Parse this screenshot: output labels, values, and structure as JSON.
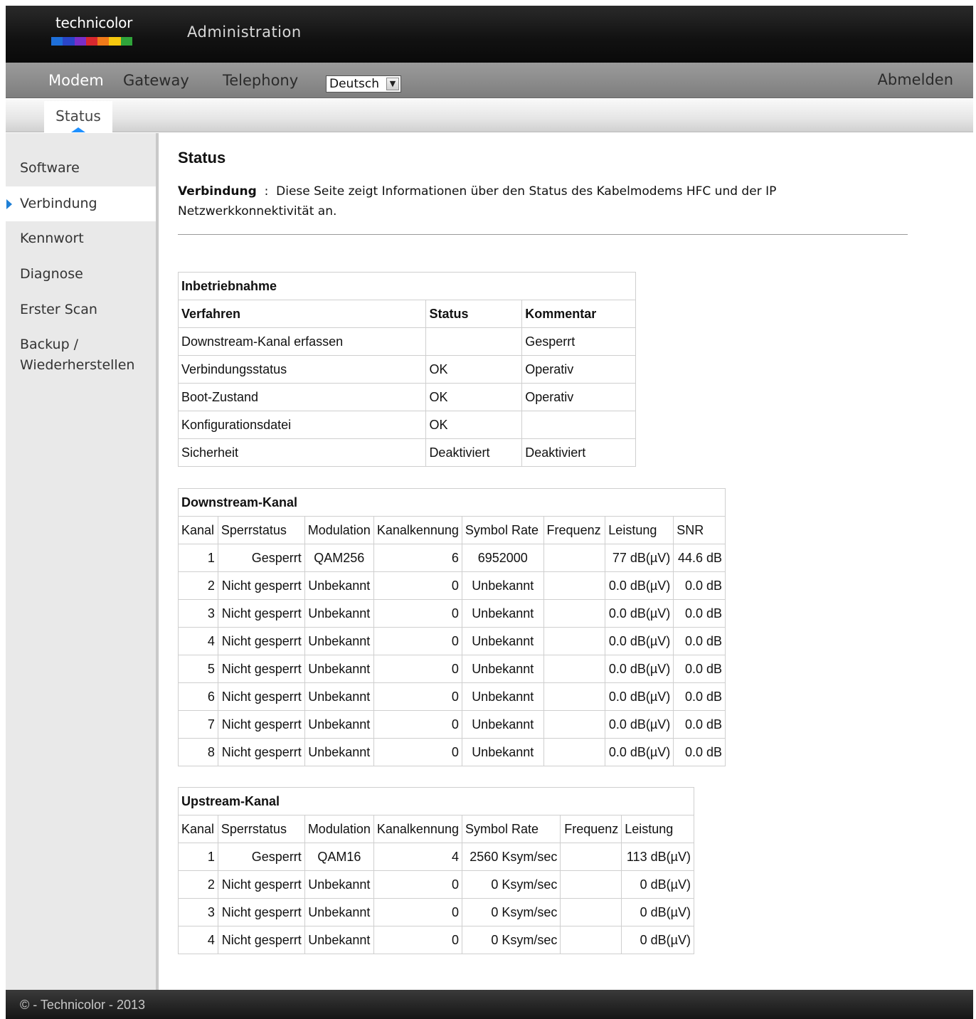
{
  "header": {
    "logo_text": "technicolor",
    "logo_colors": [
      "#1e6fd9",
      "#2a45c8",
      "#7a2ec8",
      "#d8282f",
      "#f07a19",
      "#f5c80f",
      "#2fa43a"
    ],
    "app_title": "Administration"
  },
  "nav": {
    "items": [
      {
        "label": "Modem"
      },
      {
        "label": "Gateway"
      },
      {
        "label": "Telephony"
      }
    ],
    "language": "Deutsch",
    "logout": "Abmelden"
  },
  "subnav": {
    "active_tab": "Status"
  },
  "sidebar": {
    "items": [
      {
        "label": "Software"
      },
      {
        "label": "Verbindung"
      },
      {
        "label": "Kennwort"
      },
      {
        "label": "Diagnose"
      },
      {
        "label": "Erster Scan"
      },
      {
        "label": "Backup /"
      },
      {
        "label": "Wiederherstellen"
      }
    ]
  },
  "main": {
    "title": "Status",
    "intro_label": "Verbindung",
    "intro_text_1": "  :  Diese Seite zeigt Informationen über den Status des Kabelmodems HFC und der IP",
    "intro_text_2": "Netzwerkkonnektivität an."
  },
  "provisioning": {
    "caption": "Inbetriebnahme",
    "headers": [
      "Verfahren",
      "Status",
      "Kommentar"
    ],
    "rows": [
      [
        "Downstream-Kanal erfassen",
        "",
        "Gesperrt"
      ],
      [
        "Verbindungsstatus",
        "OK",
        "Operativ"
      ],
      [
        "Boot-Zustand",
        "OK",
        "Operativ"
      ],
      [
        "Konfigurationsdatei",
        "OK",
        ""
      ],
      [
        "Sicherheit",
        "Deaktiviert",
        "Deaktiviert"
      ]
    ]
  },
  "downstream": {
    "caption": "Downstream-Kanal",
    "headers": [
      "Kanal",
      "Sperrstatus",
      "Modulation",
      "Kanalkennung",
      "Symbol Rate",
      "Frequenz",
      "Leistung",
      "SNR"
    ],
    "rows": [
      [
        "1",
        "Gesperrt",
        "QAM256",
        "6",
        "6952000",
        "",
        "77 dB(µV)",
        "44.6 dB"
      ],
      [
        "2",
        "Nicht gesperrt",
        "Unbekannt",
        "0",
        "Unbekannt",
        "",
        "0.0 dB(µV)",
        "0.0 dB"
      ],
      [
        "3",
        "Nicht gesperrt",
        "Unbekannt",
        "0",
        "Unbekannt",
        "",
        "0.0 dB(µV)",
        "0.0 dB"
      ],
      [
        "4",
        "Nicht gesperrt",
        "Unbekannt",
        "0",
        "Unbekannt",
        "",
        "0.0 dB(µV)",
        "0.0 dB"
      ],
      [
        "5",
        "Nicht gesperrt",
        "Unbekannt",
        "0",
        "Unbekannt",
        "",
        "0.0 dB(µV)",
        "0.0 dB"
      ],
      [
        "6",
        "Nicht gesperrt",
        "Unbekannt",
        "0",
        "Unbekannt",
        "",
        "0.0 dB(µV)",
        "0.0 dB"
      ],
      [
        "7",
        "Nicht gesperrt",
        "Unbekannt",
        "0",
        "Unbekannt",
        "",
        "0.0 dB(µV)",
        "0.0 dB"
      ],
      [
        "8",
        "Nicht gesperrt",
        "Unbekannt",
        "0",
        "Unbekannt",
        "",
        "0.0 dB(µV)",
        "0.0 dB"
      ]
    ]
  },
  "upstream": {
    "caption": "Upstream-Kanal",
    "headers": [
      "Kanal",
      "Sperrstatus",
      "Modulation",
      "Kanalkennung",
      "Symbol Rate",
      "Frequenz",
      "Leistung"
    ],
    "rows": [
      [
        "1",
        "Gesperrt",
        "QAM16",
        "4",
        "2560 Ksym/sec",
        "",
        "113 dB(µV)"
      ],
      [
        "2",
        "Nicht gesperrt",
        "Unbekannt",
        "0",
        "0 Ksym/sec",
        "",
        "0 dB(µV)"
      ],
      [
        "3",
        "Nicht gesperrt",
        "Unbekannt",
        "0",
        "0 Ksym/sec",
        "",
        "0 dB(µV)"
      ],
      [
        "4",
        "Nicht gesperrt",
        "Unbekannt",
        "0",
        "0 Ksym/sec",
        "",
        "0 dB(µV)"
      ]
    ]
  },
  "footer": {
    "text": "© - Technicolor - 2013"
  }
}
